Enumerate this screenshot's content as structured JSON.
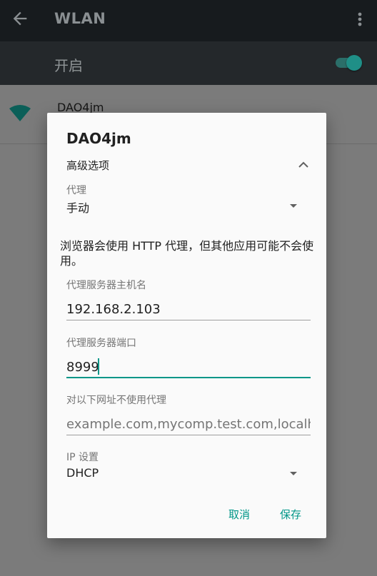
{
  "app_bar": {
    "title": "WLAN",
    "back_icon": "back-arrow-icon",
    "menu_icon": "more-vert-icon"
  },
  "wifi_switch": {
    "label": "开启",
    "on": true,
    "accent_color": "#009688"
  },
  "network": {
    "name": "DAO4jm",
    "icon": "wifi-signal-icon"
  },
  "dialog": {
    "title": "DAO4jm",
    "advanced_label": "高级选项",
    "proxy_label": "代理",
    "proxy_value": "手动",
    "proxy_note": "浏览器会使用 HTTP 代理，但其他应用可能不会使用。",
    "host_label": "代理服务器主机名",
    "host_value": "192.168.2.103",
    "port_label": "代理服务器端口",
    "port_value": "8999",
    "bypass_label": "对以下网址不使用代理",
    "bypass_placeholder": "example.com,mycomp.test.com,localhost",
    "ip_label": "IP 设置",
    "ip_value": "DHCP",
    "cancel_label": "取消",
    "save_label": "保存"
  }
}
